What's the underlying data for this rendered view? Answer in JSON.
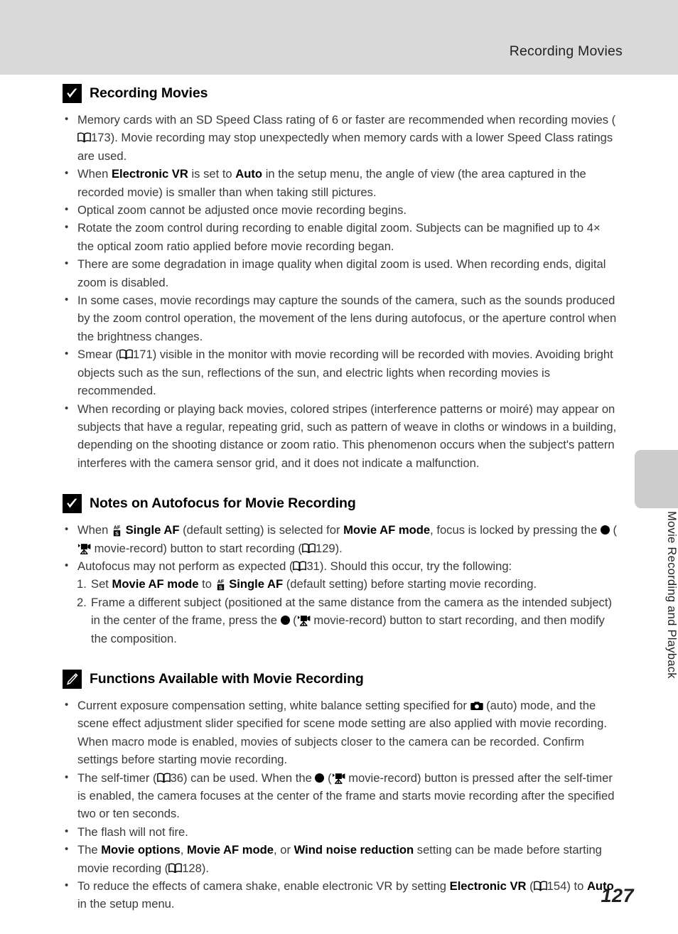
{
  "header": {
    "title": "Recording Movies"
  },
  "side_tab": {
    "label": "Movie Recording and Playback"
  },
  "footer": {
    "page_number": "127"
  },
  "icons": {
    "check_box": "checkmark-box-icon",
    "pencil_box": "pencil-box-icon",
    "book": "book-page-reference-icon",
    "movie_record": "movie-record-icon",
    "single_af": "single-af-icon",
    "camera_auto": "camera-auto-mode-icon",
    "record_dot": "record-dot-icon"
  },
  "sections": [
    {
      "icon": "checkmark-box-icon",
      "title": "Recording Movies",
      "bullets": [
        "Memory cards with an SD Speed Class rating of 6 or faster are recommended when recording movies (A 173). Movie recording may stop unexpectedly when memory cards with a lower Speed Class ratings are used.",
        "When Electronic VR is set to Auto in the setup menu, the angle of view (the area captured in the recorded movie) is smaller than when taking still pictures.",
        "Optical zoom cannot be adjusted once movie recording begins.",
        "Rotate the zoom control during recording to enable digital zoom. Subjects can be magnified up to 4× the optical zoom ratio applied before movie recording began.",
        "There are some degradation in image quality when digital zoom is used. When recording ends, digital zoom is disabled.",
        "In some cases, movie recordings may capture the sounds of the camera, such as the sounds produced by the zoom control operation, the movement of the lens during autofocus, or the aperture control when the brightness changes.",
        "Smear (A 171) visible in the monitor with movie recording will be recorded with movies. Avoiding bright objects such as the sun, reflections of the sun, and electric lights when recording movies is recommended.",
        "When recording or playing back movies, colored stripes (interference patterns or moiré) may appear on subjects that have a regular, repeating grid, such as pattern of weave in cloths or windows in a building, depending on the shooting distance or zoom ratio. This phenomenon occurs when the subject's pattern interferes with the camera sensor grid, and it does not indicate a malfunction."
      ]
    },
    {
      "icon": "checkmark-box-icon",
      "title": "Notes on Autofocus for Movie Recording",
      "bullets": [
        "When [single-af-icon] Single AF (default setting) is selected for Movie AF mode, focus is locked by pressing the ● ([movie-record-icon] movie-record) button to start recording (A 129).",
        "Autofocus may not perform as expected (A 31). Should this occur, try the following:"
      ],
      "numbered": [
        {
          "num": "1.",
          "text": "Set Movie AF mode to [single-af-icon] Single AF (default setting) before starting movie recording."
        },
        {
          "num": "2.",
          "text": "Frame a different subject (positioned at the same distance from the camera as the intended subject) in the center of the frame, press the ● ([movie-record-icon] movie-record) button to start recording, and then modify the composition."
        }
      ]
    },
    {
      "icon": "pencil-box-icon",
      "title": "Functions Available with Movie Recording",
      "bullets": [
        "Current exposure compensation setting, white balance setting specified for [camera-auto-mode-icon] (auto) mode, and the scene effect adjustment slider specified for scene mode setting are also applied with movie recording. When macro mode is enabled, movies of subjects closer to the camera can be recorded. Confirm settings before starting movie recording.",
        "The self-timer (A 36) can be used. When the ● ([movie-record-icon] movie-record) button is pressed after the self-timer is enabled, the camera focuses at the center of the frame and starts movie recording after the specified two or ten seconds.",
        "The flash will not fire.",
        "The Movie options, Movie AF mode, or Wind noise reduction setting can be made before starting movie recording (A 128).",
        "To reduce the effects of camera shake, enable electronic VR by setting Electronic VR (A 154) to Auto in the setup menu."
      ]
    }
  ],
  "text": {
    "s1_title": "Recording Movies",
    "s1_b1_a": "Memory cards with an SD Speed Class rating of 6 or faster are recommended when recording movies (",
    "s1_b1_page": "173",
    "s1_b1_b": "). Movie recording may stop unexpectedly when memory cards with a lower Speed Class ratings are used.",
    "s1_b2_a": "When ",
    "s1_b2_bold1": "Electronic VR",
    "s1_b2_b": " is set to ",
    "s1_b2_bold2": "Auto",
    "s1_b2_c": " in the setup menu, the angle of view (the area captured in the recorded movie) is smaller than when taking still pictures.",
    "s1_b3": "Optical zoom cannot be adjusted once movie recording begins.",
    "s1_b4": "Rotate the zoom control during recording to enable digital zoom. Subjects can be magnified up to 4× the optical zoom ratio applied before movie recording began.",
    "s1_b5": "There are some degradation in image quality when digital zoom is used. When recording ends, digital zoom is disabled.",
    "s1_b6": "In some cases, movie recordings may capture the sounds of the camera, such as the sounds produced by the zoom control operation, the movement of the lens during autofocus, or the aperture control when the brightness changes.",
    "s1_b7_a": "Smear (",
    "s1_b7_page": "171",
    "s1_b7_b": ") visible in the monitor with movie recording will be recorded with movies. Avoiding bright objects such as the sun, reflections of the sun, and electric lights when recording movies is recommended.",
    "s1_b8": "When recording or playing back movies, colored stripes (interference patterns or moiré) may appear on subjects that have a regular, repeating grid, such as pattern of weave in cloths or windows in a building, depending on the shooting distance or zoom ratio. This phenomenon occurs when the subject's pattern interferes with the camera sensor grid, and it does not indicate a malfunction.",
    "s2_title": "Notes on Autofocus for Movie Recording",
    "s2_b1_a": "When ",
    "s2_b1_bold1": "Single AF",
    "s2_b1_b": " (default setting) is selected for ",
    "s2_b1_bold2": "Movie AF mode",
    "s2_b1_c": ", focus is locked by pressing the ",
    "s2_b1_d": " (",
    "s2_b1_e": " movie-record) button to start recording (",
    "s2_b1_page": "129",
    "s2_b1_f": ").",
    "s2_b2_a": "Autofocus may not perform as expected (",
    "s2_b2_page": "31",
    "s2_b2_b": "). Should this occur, try the following:",
    "s2_n1_num": "1.",
    "s2_n1_a": "Set ",
    "s2_n1_bold1": "Movie AF mode",
    "s2_n1_b": " to ",
    "s2_n1_bold2": "Single AF",
    "s2_n1_c": " (default setting) before starting movie recording.",
    "s2_n2_num": "2.",
    "s2_n2_a": "Frame a different subject (positioned at the same distance from the camera as the intended subject) in the center of the frame, press the ",
    "s2_n2_b": " (",
    "s2_n2_c": " movie-record) button to start recording, and then modify the composition.",
    "s3_title": "Functions Available with Movie Recording",
    "s3_b1_a": "Current exposure compensation setting, white balance setting specified for ",
    "s3_b1_b": " (auto) mode, and the scene effect adjustment slider specified for scene mode setting are also applied with movie recording. When macro mode is enabled, movies of subjects closer to the camera can be recorded. Confirm settings before starting movie recording.",
    "s3_b2_a": "The self-timer (",
    "s3_b2_page": "36",
    "s3_b2_b": ") can be used. When the ",
    "s3_b2_c": " (",
    "s3_b2_d": " movie-record) button is pressed after the self-timer is enabled, the camera focuses at the center of the frame and starts movie recording after the specified two or ten seconds.",
    "s3_b3": "The flash will not fire.",
    "s3_b4_a": "The ",
    "s3_b4_bold1": "Movie options",
    "s3_b4_b": ", ",
    "s3_b4_bold2": "Movie AF mode",
    "s3_b4_c": ", or ",
    "s3_b4_bold3": "Wind noise reduction",
    "s3_b4_d": " setting can be made before starting movie recording (",
    "s3_b4_page": "128",
    "s3_b4_e": ").",
    "s3_b5_a": "To reduce the effects of camera shake, enable electronic VR by setting ",
    "s3_b5_bold1": "Electronic VR",
    "s3_b5_b": " (",
    "s3_b5_page": "154",
    "s3_b5_c": ") to ",
    "s3_b5_bold2": "Auto",
    "s3_b5_d": " in the setup menu."
  },
  "colors": {
    "header_band": "#d9d9d9",
    "side_tab": "#cccccc",
    "body_text": "#3a3a3a",
    "heading_text": "#000000",
    "page_background": "#ffffff"
  }
}
